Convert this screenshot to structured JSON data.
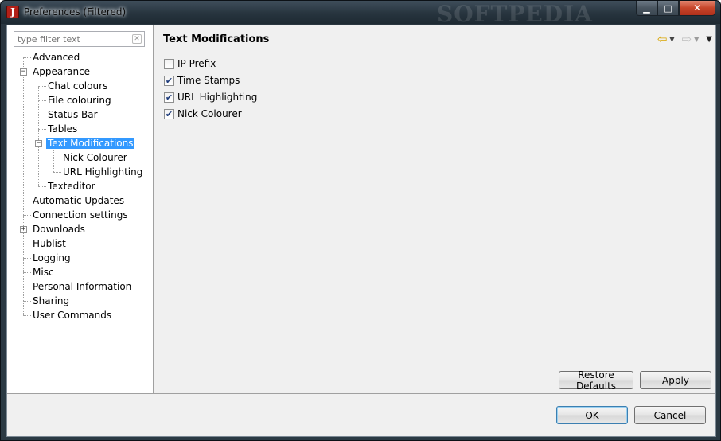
{
  "window": {
    "title": "Preferences (Filtered)",
    "app_icon_letter": "J",
    "watermark": "SOFTPEDIA"
  },
  "filter": {
    "placeholder": "type filter text"
  },
  "tree": {
    "items": [
      {
        "label": "Advanced"
      },
      {
        "label": "Appearance",
        "expanded": true
      },
      {
        "label": "Chat colours"
      },
      {
        "label": "File colouring"
      },
      {
        "label": "Status Bar"
      },
      {
        "label": "Tables"
      },
      {
        "label": "Text Modifications",
        "expanded": true,
        "selected": true
      },
      {
        "label": "Nick Colourer"
      },
      {
        "label": "URL Highlighting"
      },
      {
        "label": "Texteditor"
      },
      {
        "label": "Automatic Updates"
      },
      {
        "label": "Connection settings"
      },
      {
        "label": "Downloads",
        "expanded": false
      },
      {
        "label": "Hublist"
      },
      {
        "label": "Logging"
      },
      {
        "label": "Misc"
      },
      {
        "label": "Personal Information"
      },
      {
        "label": "Sharing"
      },
      {
        "label": "User Commands"
      }
    ]
  },
  "page": {
    "title": "Text Modifications",
    "options": [
      {
        "label": "IP Prefix",
        "checked": false
      },
      {
        "label": "Time Stamps",
        "checked": true
      },
      {
        "label": "URL Highlighting",
        "checked": true
      },
      {
        "label": "Nick Colourer",
        "checked": true
      }
    ],
    "restore_label": "Restore Defaults",
    "apply_label": "Apply"
  },
  "dialog": {
    "ok_label": "OK",
    "cancel_label": "Cancel"
  },
  "colors": {
    "selection": "#3399ff",
    "back_arrow": "#d8a400"
  }
}
